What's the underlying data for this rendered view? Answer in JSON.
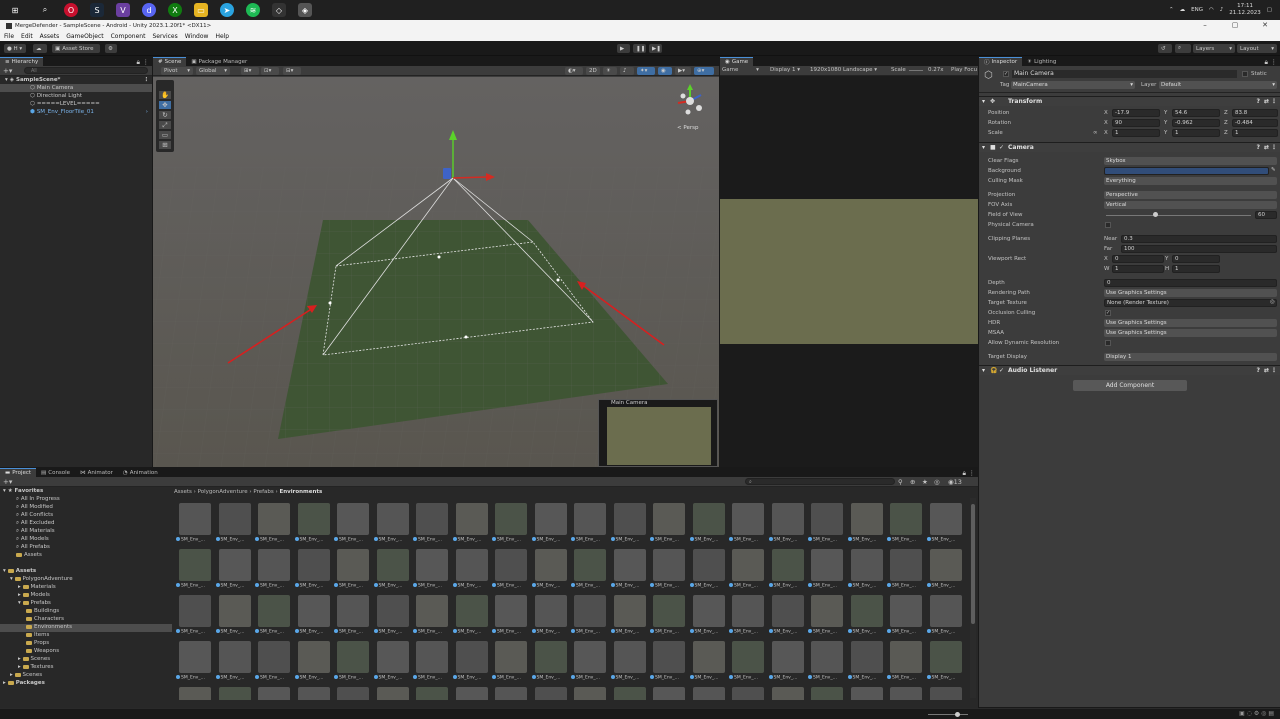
{
  "taskbar": {
    "lang": "ENG",
    "time": "17:11",
    "date": "21.12.2023"
  },
  "window": {
    "title": "MergeDefender - SampleScene - Android - Unity 2023.1.20f1* <DX11>"
  },
  "menu": [
    "File",
    "Edit",
    "Assets",
    "GameObject",
    "Component",
    "Services",
    "Window",
    "Help"
  ],
  "toolbar": {
    "asset_store": "Asset Store",
    "layers": "Layers",
    "layout": "Layout"
  },
  "hierarchy": {
    "tab": "Hierarchy",
    "search_placeholder": "All",
    "items": [
      "SampleScene*",
      "Main Camera",
      "Directional Light",
      "=====LEVEL=====",
      "SM_Env_FloorTile_01"
    ]
  },
  "scene": {
    "tabs": [
      "Scene",
      "Package Manager"
    ],
    "pivot": "Pivot",
    "global": "Global",
    "mode_2d": "2D",
    "persp": "< Persp",
    "preview_title": "Main Camera"
  },
  "game": {
    "tab": "Game",
    "display_mode": "Game",
    "display": "Display 1",
    "resolution": "1920x1080 Landscape",
    "scale_label": "Scale",
    "scale_value": "0.27x",
    "play_focused": "Play Focu"
  },
  "inspector": {
    "tabs": [
      "Inspector",
      "Lighting"
    ],
    "object_name": "Main Camera",
    "static": "Static",
    "tag_label": "Tag",
    "tag": "MainCamera",
    "layer_label": "Layer",
    "layer": "Default",
    "transform": {
      "title": "Transform",
      "position_label": "Position",
      "rotation_label": "Rotation",
      "scale_label": "Scale",
      "position": [
        "-17.9",
        "54.6",
        "83.8"
      ],
      "rotation": [
        "90",
        "-0.962",
        "-0.484"
      ],
      "scale": [
        "1",
        "1",
        "1"
      ]
    },
    "camera": {
      "title": "Camera",
      "rows": [
        {
          "label": "Clear Flags",
          "value": "Skybox"
        },
        {
          "label": "Background",
          "value": ""
        },
        {
          "label": "Culling Mask",
          "value": "Everything"
        },
        {
          "label": "Projection",
          "value": "Perspective"
        },
        {
          "label": "FOV Axis",
          "value": "Vertical"
        },
        {
          "label": "Field of View",
          "value": "60"
        },
        {
          "label": "Physical Camera",
          "value": ""
        },
        {
          "label": "Clipping Planes",
          "value": ""
        },
        {
          "label": "Viewport Rect",
          "value": ""
        },
        {
          "label": "Depth",
          "value": "0"
        },
        {
          "label": "Rendering Path",
          "value": "Use Graphics Settings"
        },
        {
          "label": "Target Texture",
          "value": "None (Render Texture)"
        },
        {
          "label": "Occlusion Culling",
          "value": ""
        },
        {
          "label": "HDR",
          "value": "Use Graphics Settings"
        },
        {
          "label": "MSAA",
          "value": "Use Graphics Settings"
        },
        {
          "label": "Allow Dynamic Resolution",
          "value": ""
        },
        {
          "label": "Target Display",
          "value": "Display 1"
        }
      ],
      "near_label": "Near",
      "near": "0.3",
      "far_label": "Far",
      "far": "100",
      "vp_x": "0",
      "vp_y": "0",
      "vp_w": "1",
      "vp_h": "1",
      "background_color": "#314d79"
    },
    "audio_listener": "Audio Listener",
    "add_component": "Add Component"
  },
  "project": {
    "tabs": [
      "Project",
      "Console",
      "Animator",
      "Animation"
    ],
    "favorites_title": "Favorites",
    "favorites": [
      "All In Progress",
      "All Modified",
      "All Conflicts",
      "All Excluded",
      "All Materials",
      "All Models",
      "All Prefabs",
      "Assets"
    ],
    "assets_title": "Assets",
    "tree": [
      {
        "name": "PolygonAdventure",
        "level": 1
      },
      {
        "name": "Materials",
        "level": 2
      },
      {
        "name": "Models",
        "level": 2
      },
      {
        "name": "Prefabs",
        "level": 2
      },
      {
        "name": "Buildings",
        "level": 3
      },
      {
        "name": "Characters",
        "level": 3
      },
      {
        "name": "Environments",
        "level": 3
      },
      {
        "name": "Items",
        "level": 3
      },
      {
        "name": "Props",
        "level": 3
      },
      {
        "name": "Weapons",
        "level": 3
      },
      {
        "name": "Scenes",
        "level": 2
      },
      {
        "name": "Textures",
        "level": 2
      },
      {
        "name": "Scenes",
        "level": 1
      }
    ],
    "packages_title": "Packages",
    "breadcrumb": [
      "Assets",
      "PolygonAdventure",
      "Prefabs",
      "Environments"
    ],
    "count": "13",
    "asset_label": "SM_Env_..."
  }
}
